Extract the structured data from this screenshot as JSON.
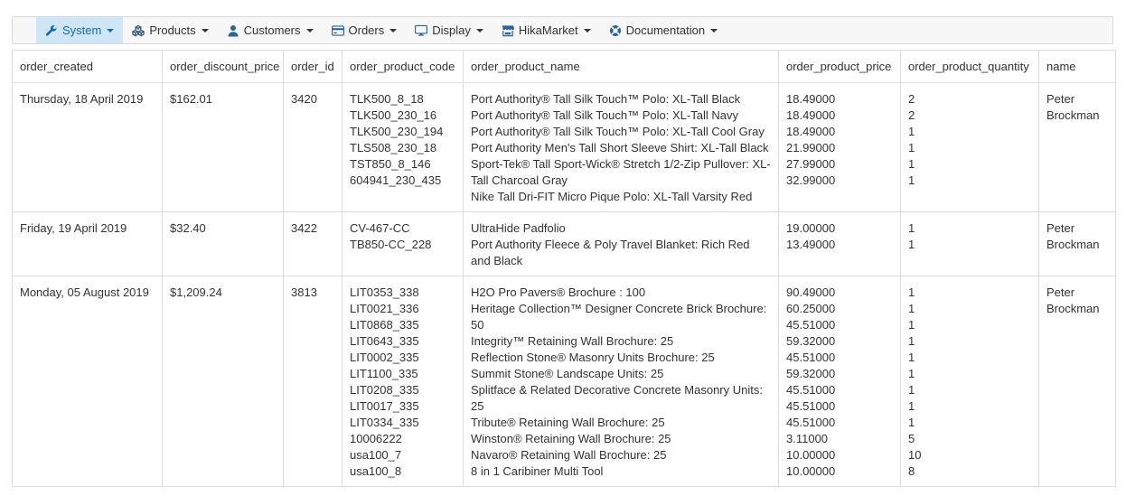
{
  "menu": [
    {
      "label": "System",
      "icon": "wrench-icon",
      "active": true
    },
    {
      "label": "Products",
      "icon": "cubes-icon",
      "active": false
    },
    {
      "label": "Customers",
      "icon": "user-icon",
      "active": false
    },
    {
      "label": "Orders",
      "icon": "credit-card-icon",
      "active": false
    },
    {
      "label": "Display",
      "icon": "monitor-icon",
      "active": false
    },
    {
      "label": "HikaMarket",
      "icon": "store-icon",
      "active": false
    },
    {
      "label": "Documentation",
      "icon": "lifebuoy-icon",
      "active": false
    }
  ],
  "columns": [
    "order_created",
    "order_discount_price",
    "order_id",
    "order_product_code",
    "order_product_name",
    "order_product_price",
    "order_product_quantity",
    "name"
  ],
  "rows": [
    {
      "order_created": "Thursday, 18 April 2019",
      "order_discount_price": "$162.01",
      "order_id": "3420",
      "order_product_code": [
        "TLK500_8_18",
        "TLK500_230_16",
        "TLK500_230_194",
        "TLS508_230_18",
        "TST850_8_146",
        "604941_230_435"
      ],
      "order_product_name": [
        "Port Authority® Tall Silk Touch™ Polo: XL-Tall Black",
        "Port Authority® Tall Silk Touch™ Polo: XL-Tall Navy",
        "Port Authority® Tall Silk Touch™ Polo: XL-Tall Cool Gray",
        "Port Authority Men's Tall Short Sleeve Shirt: XL-Tall Black",
        "Sport-Tek® Tall Sport-Wick® Stretch 1/2-Zip Pullover: XL-Tall Charcoal Gray",
        "Nike Tall Dri-FIT Micro Pique Polo: XL-Tall Varsity Red"
      ],
      "order_product_price": [
        "18.49000",
        "18.49000",
        "18.49000",
        "21.99000",
        "27.99000",
        "32.99000"
      ],
      "order_product_quantity": [
        "2",
        "2",
        "1",
        "1",
        "1",
        "1"
      ],
      "name": "Peter Brockman"
    },
    {
      "order_created": "Friday, 19 April 2019",
      "order_discount_price": "$32.40",
      "order_id": "3422",
      "order_product_code": [
        "CV-467-CC",
        "TB850-CC_228"
      ],
      "order_product_name": [
        "UltraHide Padfolio",
        "Port Authority Fleece & Poly Travel Blanket: Rich Red and Black"
      ],
      "order_product_price": [
        "19.00000",
        "13.49000"
      ],
      "order_product_quantity": [
        "1",
        "1"
      ],
      "name": "Peter Brockman"
    },
    {
      "order_created": "Monday, 05 August 2019",
      "order_discount_price": "$1,209.24",
      "order_id": "3813",
      "order_product_code": [
        "LIT0353_338",
        "LIT0021_336",
        "LIT0868_335",
        "LIT0643_335",
        "LIT0002_335",
        "LIT1100_335",
        "LIT0208_335",
        "LIT0017_335",
        "LIT0334_335",
        "10006222",
        "usa100_7",
        "usa100_8"
      ],
      "order_product_name": [
        "H2O Pro Pavers® Brochure : 100",
        "Heritage Collection™ Designer Concrete Brick Brochure: 50",
        "Integrity™ Retaining Wall Brochure: 25",
        "Reflection Stone® Masonry Units Brochure: 25",
        "Summit Stone® Landscape Units: 25",
        "Splitface & Related Decorative Concrete Masonry Units: 25",
        "Tribute® Retaining Wall Brochure: 25",
        "Winston® Retaining Wall Brochure: 25",
        "Navaro® Retaining Wall Brochure: 25",
        "8 in 1 Caribiner Multi Tool"
      ],
      "order_product_price": [
        "90.49000",
        "60.25000",
        "45.51000",
        "59.32000",
        "45.51000",
        "59.32000",
        "45.51000",
        "45.51000",
        "45.51000",
        "3.11000",
        "10.00000",
        "10.00000"
      ],
      "order_product_quantity": [
        "1",
        "1",
        "1",
        "1",
        "1",
        "1",
        "1",
        "1",
        "1",
        "5",
        "10",
        "8"
      ],
      "name": "Peter Brockman"
    }
  ],
  "colors": {
    "accent": "#1a6aa6",
    "active_bg": "#cfe6f7",
    "border": "#dddddd"
  }
}
